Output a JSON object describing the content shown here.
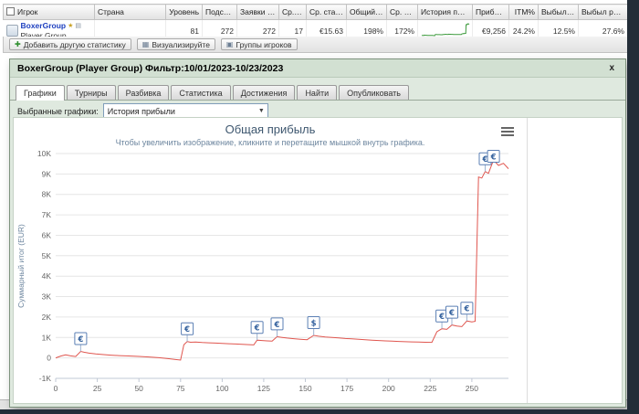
{
  "table": {
    "columns": [
      "Игрок",
      "Страна",
      "Уровень",
      "Подсчет",
      "Заявки и у...",
      "Ср. игры",
      "Ср. ставка",
      "Общий ROI",
      "Ср. ROI",
      "История прибыли",
      "Прибыль",
      "ITM%",
      "Выбыл рано",
      "Выбыл рано/с..."
    ],
    "row": {
      "player": "BoxerGroup",
      "player_sub": "Player Group",
      "country": "",
      "level": "81",
      "count": "272",
      "entries": "272",
      "avg_games": "17",
      "avg_stake": "€15.63",
      "total_roi": "198%",
      "avg_roi": "172%",
      "profit": "€9,256",
      "itm": "24.2%",
      "early_bust": "12.5%",
      "early_bust2": "27.6%"
    }
  },
  "toolbar": {
    "add_label": "Добавить другую статистику",
    "visualize_label": "Визуализируйте",
    "groups_label": "Группы игроков"
  },
  "dialog": {
    "title": "BoxerGroup (Player Group) Фильтр:10/01/2023-10/23/2023",
    "close_label": "x",
    "tabs": [
      {
        "label": "Графики",
        "active": true
      },
      {
        "label": "Турниры",
        "active": false
      },
      {
        "label": "Разбивка",
        "active": false
      },
      {
        "label": "Статистика",
        "active": false
      },
      {
        "label": "Достижения",
        "active": false
      },
      {
        "label": "Найти",
        "active": false
      },
      {
        "label": "Опубликовать",
        "active": false
      }
    ],
    "charts_select_label": "Выбранные графики:",
    "selected_chart": "История прибыли"
  },
  "chart_data": {
    "type": "line",
    "title": "Общая прибыль",
    "subtitle": "Чтобы увеличить изображение, кликните и перетащите мышкой внутрь графика.",
    "ylabel": "Суммарный итог (EUR)",
    "xlim": [
      0,
      272
    ],
    "ylim": [
      -1000,
      10000
    ],
    "x_ticks": [
      0,
      25,
      50,
      75,
      100,
      125,
      150,
      175,
      200,
      225,
      250
    ],
    "y_ticks": [
      {
        "v": -1000,
        "label": "-1K"
      },
      {
        "v": 0,
        "label": "0"
      },
      {
        "v": 1000,
        "label": "1K"
      },
      {
        "v": 2000,
        "label": "2K"
      },
      {
        "v": 3000,
        "label": "3K"
      },
      {
        "v": 4000,
        "label": "4K"
      },
      {
        "v": 5000,
        "label": "5K"
      },
      {
        "v": 6000,
        "label": "6K"
      },
      {
        "v": 7000,
        "label": "7K"
      },
      {
        "v": 8000,
        "label": "8K"
      },
      {
        "v": 9000,
        "label": "9K"
      },
      {
        "v": 10000,
        "label": "10K"
      }
    ],
    "line_color": "#e0564f",
    "grid_color": "#e6e6e6",
    "marker_border": "#5b7fb4",
    "spark_color": "#3c9a3c",
    "series": [
      {
        "name": "История прибыли",
        "points": [
          [
            0,
            0
          ],
          [
            3,
            90
          ],
          [
            6,
            150
          ],
          [
            9,
            100
          ],
          [
            12,
            70
          ],
          [
            15,
            320
          ],
          [
            17,
            280
          ],
          [
            20,
            235
          ],
          [
            24,
            195
          ],
          [
            28,
            165
          ],
          [
            33,
            135
          ],
          [
            38,
            115
          ],
          [
            44,
            95
          ],
          [
            50,
            75
          ],
          [
            56,
            45
          ],
          [
            62,
            10
          ],
          [
            68,
            -40
          ],
          [
            72,
            -80
          ],
          [
            75,
            -105
          ],
          [
            77,
            640
          ],
          [
            79,
            800
          ],
          [
            81,
            765
          ],
          [
            84,
            775
          ],
          [
            88,
            755
          ],
          [
            92,
            740
          ],
          [
            96,
            725
          ],
          [
            100,
            710
          ],
          [
            104,
            695
          ],
          [
            108,
            680
          ],
          [
            112,
            665
          ],
          [
            116,
            650
          ],
          [
            119,
            635
          ],
          [
            121,
            870
          ],
          [
            124,
            850
          ],
          [
            127,
            835
          ],
          [
            130,
            820
          ],
          [
            133,
            1040
          ],
          [
            136,
            1005
          ],
          [
            139,
            970
          ],
          [
            143,
            940
          ],
          [
            147,
            915
          ],
          [
            151,
            890
          ],
          [
            155,
            1100
          ],
          [
            158,
            1060
          ],
          [
            162,
            1025
          ],
          [
            166,
            1000
          ],
          [
            170,
            975
          ],
          [
            174,
            950
          ],
          [
            178,
            930
          ],
          [
            182,
            910
          ],
          [
            186,
            890
          ],
          [
            190,
            870
          ],
          [
            194,
            850
          ],
          [
            198,
            835
          ],
          [
            202,
            820
          ],
          [
            206,
            805
          ],
          [
            210,
            792
          ],
          [
            214,
            782
          ],
          [
            218,
            773
          ],
          [
            222,
            766
          ],
          [
            226,
            760
          ],
          [
            229,
            1280
          ],
          [
            232,
            1430
          ],
          [
            235,
            1395
          ],
          [
            238,
            1610
          ],
          [
            241,
            1560
          ],
          [
            244,
            1530
          ],
          [
            247,
            1810
          ],
          [
            250,
            1765
          ],
          [
            252,
            1790
          ],
          [
            254,
            8850
          ],
          [
            256,
            8800
          ],
          [
            258,
            9120
          ],
          [
            260,
            9030
          ],
          [
            263,
            9680
          ],
          [
            266,
            9420
          ],
          [
            269,
            9520
          ],
          [
            272,
            9256
          ]
        ]
      }
    ],
    "markers": [
      {
        "x": 15,
        "y": 320,
        "symbol": "€"
      },
      {
        "x": 79,
        "y": 800,
        "symbol": "€"
      },
      {
        "x": 121,
        "y": 870,
        "symbol": "€"
      },
      {
        "x": 133,
        "y": 1040,
        "symbol": "€"
      },
      {
        "x": 155,
        "y": 1100,
        "symbol": "$"
      },
      {
        "x": 232,
        "y": 1430,
        "symbol": "€"
      },
      {
        "x": 238,
        "y": 1610,
        "symbol": "€"
      },
      {
        "x": 247,
        "y": 1810,
        "symbol": "€"
      },
      {
        "x": 258,
        "y": 9120,
        "symbol": "€"
      },
      {
        "x": 263,
        "y": 9680,
        "symbol": "€"
      }
    ]
  }
}
